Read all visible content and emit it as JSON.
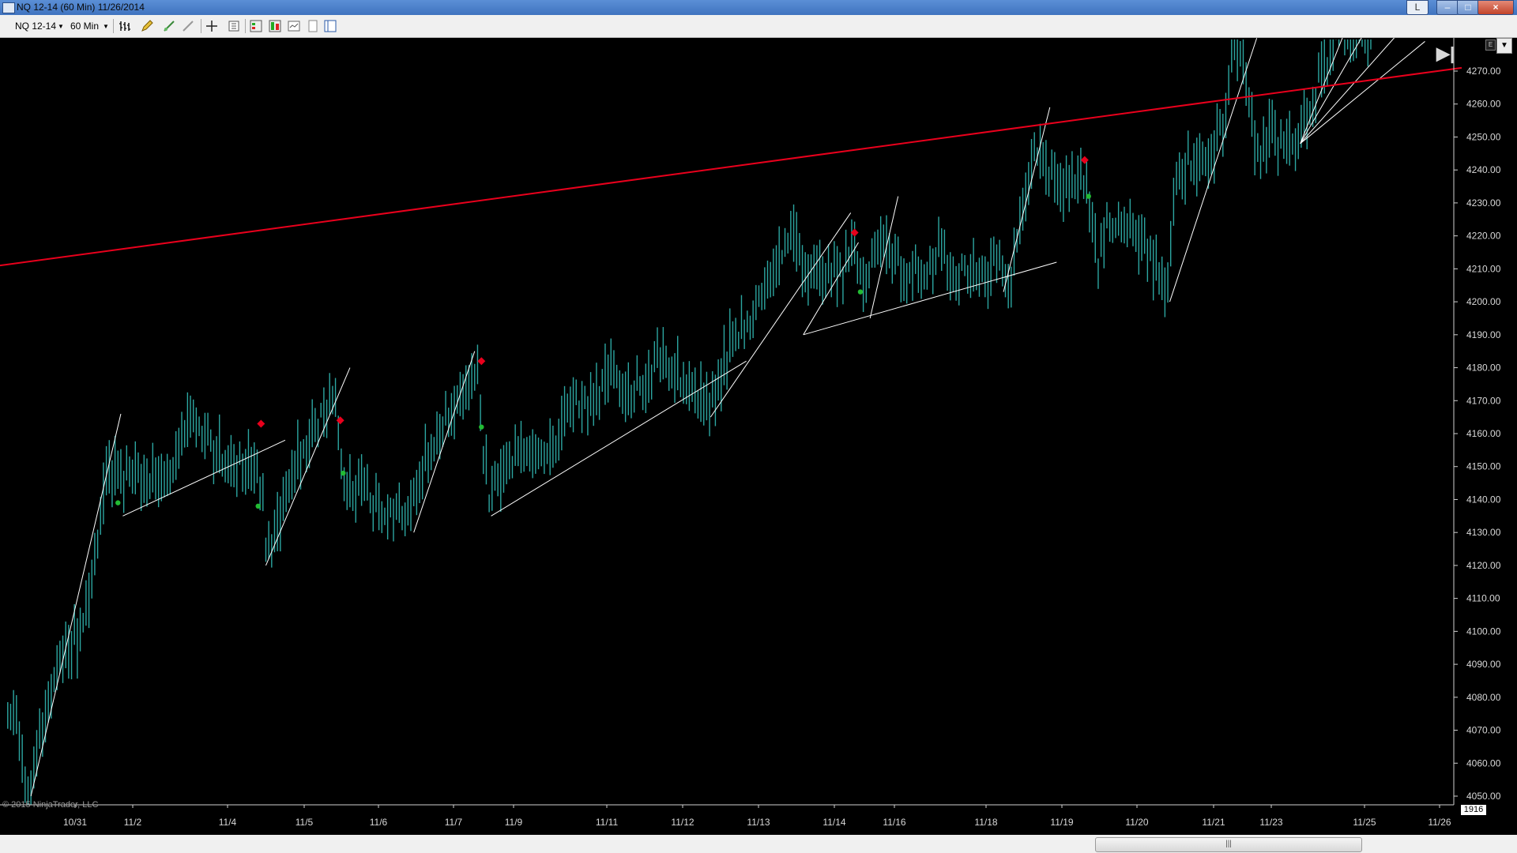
{
  "window": {
    "title": "NQ 12-14 (60 Min)  11/26/2014",
    "l_button": "L",
    "minimize": "–",
    "maximize": "□",
    "close": "×"
  },
  "toolbar": {
    "instrument": "NQ 12-14",
    "interval": "60 Min",
    "icons": [
      "bar-type-icon",
      "drawing-pencil-icon",
      "add-indicator-icon",
      "strategy-icon",
      "crosshair-icon",
      "data-box-icon",
      "chart-trader-icon",
      "strategy-analyzer-icon",
      "properties-icon",
      "doc-icon",
      "layout-icon"
    ]
  },
  "chart_data": {
    "type": "bar",
    "instrument": "NQ 12-14",
    "bar_color": "#2ca6a1",
    "trendline_color": "#ffffff",
    "channel_line_color": "#e8001c",
    "signal_high_color": "#e8001c",
    "signal_low_color": "#22bb33",
    "ylim": [
      4047,
      4280
    ],
    "y_ticks": [
      "4270.00",
      "4260.00",
      "4250.00",
      "4240.00",
      "4230.00",
      "4220.00",
      "4210.00",
      "4200.00",
      "4190.00",
      "4180.00",
      "4170.00",
      "4160.00",
      "4150.00",
      "4140.00",
      "4130.00",
      "4120.00",
      "4110.00",
      "4100.00",
      "4090.00",
      "4080.00",
      "4070.00",
      "4060.00",
      "4050.00"
    ],
    "x_ticks": [
      "10/31",
      "11/2",
      "11/4",
      "11/5",
      "11/6",
      "11/7",
      "11/9",
      "11/11",
      "11/12",
      "11/13",
      "11/14",
      "11/16",
      "11/18",
      "11/19",
      "11/20",
      "11/21",
      "11/23",
      "11/25",
      "11/26"
    ],
    "last_bar_count": "1916",
    "path_knots": [
      [
        0,
        4078
      ],
      [
        18,
        4072
      ],
      [
        28,
        4050
      ],
      [
        42,
        4068
      ],
      [
        60,
        4090
      ],
      [
        80,
        4098
      ],
      [
        95,
        4115
      ],
      [
        110,
        4150
      ],
      [
        125,
        4145
      ],
      [
        140,
        4150
      ],
      [
        160,
        4145
      ],
      [
        180,
        4148
      ],
      [
        195,
        4165
      ],
      [
        215,
        4158
      ],
      [
        235,
        4150
      ],
      [
        255,
        4153
      ],
      [
        270,
        4145
      ],
      [
        275,
        4125
      ],
      [
        290,
        4135
      ],
      [
        310,
        4155
      ],
      [
        330,
        4165
      ],
      [
        345,
        4170
      ],
      [
        352,
        4155
      ],
      [
        358,
        4140
      ],
      [
        375,
        4145
      ],
      [
        400,
        4135
      ],
      [
        425,
        4138
      ],
      [
        445,
        4155
      ],
      [
        465,
        4165
      ],
      [
        480,
        4175
      ],
      [
        495,
        4178
      ],
      [
        500,
        4155
      ],
      [
        507,
        4138
      ],
      [
        520,
        4150
      ],
      [
        540,
        4155
      ],
      [
        555,
        4153
      ],
      [
        570,
        4155
      ],
      [
        590,
        4170
      ],
      [
        610,
        4168
      ],
      [
        630,
        4178
      ],
      [
        650,
        4175
      ],
      [
        665,
        4172
      ],
      [
        680,
        4182
      ],
      [
        700,
        4178
      ],
      [
        720,
        4172
      ],
      [
        735,
        4168
      ],
      [
        745,
        4178
      ],
      [
        760,
        4190
      ],
      [
        775,
        4195
      ],
      [
        790,
        4202
      ],
      [
        805,
        4212
      ],
      [
        820,
        4225
      ],
      [
        830,
        4208
      ],
      [
        845,
        4210
      ],
      [
        860,
        4208
      ],
      [
        875,
        4212
      ],
      [
        885,
        4215
      ],
      [
        895,
        4205
      ],
      [
        905,
        4215
      ],
      [
        920,
        4220
      ],
      [
        935,
        4205
      ],
      [
        950,
        4210
      ],
      [
        965,
        4210
      ],
      [
        975,
        4215
      ],
      [
        985,
        4210
      ],
      [
        1000,
        4210
      ],
      [
        1020,
        4210
      ],
      [
        1035,
        4215
      ],
      [
        1045,
        4208
      ],
      [
        1055,
        4225
      ],
      [
        1070,
        4245
      ],
      [
        1085,
        4238
      ],
      [
        1100,
        4235
      ],
      [
        1110,
        4238
      ],
      [
        1120,
        4236
      ],
      [
        1128,
        4228
      ],
      [
        1135,
        4210
      ],
      [
        1145,
        4225
      ],
      [
        1160,
        4223
      ],
      [
        1175,
        4220
      ],
      [
        1190,
        4215
      ],
      [
        1200,
        4205
      ],
      [
        1208,
        4205
      ],
      [
        1215,
        4235
      ],
      [
        1230,
        4243
      ],
      [
        1245,
        4240
      ],
      [
        1260,
        4250
      ],
      [
        1270,
        4262
      ],
      [
        1278,
        4280
      ],
      [
        1285,
        4275
      ],
      [
        1292,
        4260
      ],
      [
        1300,
        4245
      ],
      [
        1315,
        4250
      ],
      [
        1330,
        4248
      ],
      [
        1345,
        4250
      ],
      [
        1360,
        4262
      ],
      [
        1370,
        4272
      ],
      [
        1380,
        4280
      ],
      [
        1395,
        4282
      ],
      [
        1425,
        4283
      ]
    ],
    "swing_lines": [
      [
        [
          32,
          4050
        ],
        [
          125,
          4166
        ]
      ],
      [
        [
          127,
          4135
        ],
        [
          295,
          4158
        ]
      ],
      [
        [
          275,
          4120
        ],
        [
          362,
          4180
        ]
      ],
      [
        [
          428,
          4130
        ],
        [
          491,
          4185
        ]
      ],
      [
        [
          508,
          4135
        ],
        [
          772,
          4182
        ]
      ],
      [
        [
          735,
          4165
        ],
        [
          880,
          4227
        ]
      ],
      [
        [
          831,
          4190
        ],
        [
          888,
          4218
        ]
      ],
      [
        [
          831,
          4190
        ],
        [
          1093,
          4212
        ]
      ],
      [
        [
          900,
          4195
        ],
        [
          929,
          4232
        ]
      ],
      [
        [
          1038,
          4203
        ],
        [
          1086,
          4259
        ]
      ],
      [
        [
          1210,
          4200
        ],
        [
          1300,
          4280
        ]
      ],
      [
        [
          1345,
          4248
        ],
        [
          1398,
          4287
        ]
      ],
      [
        [
          1345,
          4248
        ],
        [
          1418,
          4285
        ]
      ],
      [
        [
          1345,
          4248
        ],
        [
          1448,
          4282
        ]
      ],
      [
        [
          1345,
          4248
        ],
        [
          1474,
          4279
        ]
      ]
    ],
    "channel_line": [
      [
        0,
        4211
      ],
      [
        1512,
        4271
      ]
    ],
    "high_signals": [
      [
        270,
        4163
      ],
      [
        352,
        4164
      ],
      [
        498,
        4182
      ],
      [
        884,
        4221
      ],
      [
        1122,
        4243
      ]
    ],
    "low_signals": [
      [
        122,
        4139
      ],
      [
        267,
        4138
      ],
      [
        355,
        4148
      ],
      [
        498,
        4162
      ],
      [
        890,
        4203
      ],
      [
        1126,
        4232
      ]
    ]
  },
  "copyright": "© 2015 NinjaTrader, LLC",
  "scrollbar": {
    "thumb_label": "|||"
  }
}
